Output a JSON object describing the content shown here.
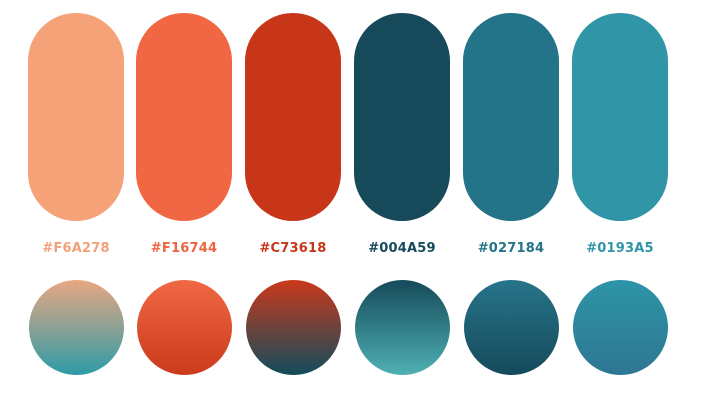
{
  "swatches": [
    {
      "hex_label": "#F6A278",
      "color": "#F6A278",
      "label_color": "#F2A07A",
      "circle_gradient": [
        "#E9A782",
        "#2D9BA6"
      ]
    },
    {
      "hex_label": "#F16744",
      "color": "#F16744",
      "label_color": "#EE6440",
      "circle_gradient": [
        "#F06844",
        "#CB3A1C"
      ]
    },
    {
      "hex_label": "#C73618",
      "color": "#C73618",
      "label_color": "#C73618",
      "circle_gradient": [
        "#CA391B",
        "#124C5C"
      ]
    },
    {
      "hex_label": "#004A59",
      "color": "#164A5A",
      "label_color": "#164A5A",
      "circle_gradient": [
        "#154A59",
        "#4FB0B4"
      ]
    },
    {
      "hex_label": "#027184",
      "color": "#247489",
      "label_color": "#247489",
      "circle_gradient": [
        "#27748A",
        "#154A5B"
      ]
    },
    {
      "hex_label": "#0193A5",
      "color": "#2F95A7",
      "label_color": "#2F95A7",
      "circle_gradient": [
        "#2D95A7",
        "#2E7692"
      ]
    }
  ]
}
